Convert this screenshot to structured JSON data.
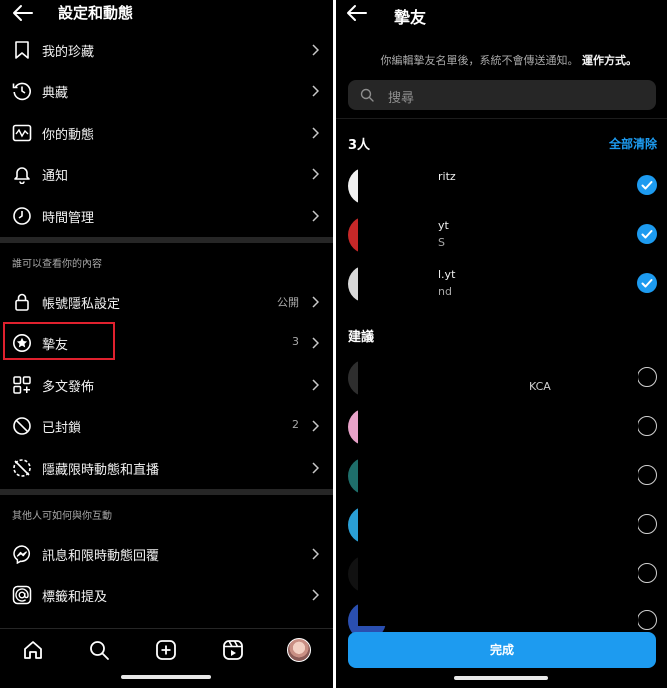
{
  "left_panel": {
    "header": {
      "title": "設定和動態"
    },
    "top_items": [
      {
        "label": "我的珍藏",
        "icon": "bookmark-icon"
      },
      {
        "label": "典藏",
        "icon": "archive-history-icon"
      },
      {
        "label": "你的動態",
        "icon": "activity-icon"
      },
      {
        "label": "通知",
        "icon": "bell-icon"
      },
      {
        "label": "時間管理",
        "icon": "clock-icon"
      }
    ],
    "section1_title": "誰可以查看你的內容",
    "section1_items": [
      {
        "label": "帳號隱私設定",
        "value": "公開",
        "icon": "lock-icon"
      },
      {
        "label": "摯友",
        "value": "3",
        "icon": "close-friends-star-icon"
      },
      {
        "label": "多文發佈",
        "value": "",
        "icon": "crossposting-icon"
      },
      {
        "label": "已封鎖",
        "value": "2",
        "icon": "blocked-icon"
      },
      {
        "label": "隱藏限時動態和直播",
        "value": "",
        "icon": "hide-story-icon"
      }
    ],
    "section2_title": "其他人可如何與你互動",
    "section2_items": [
      {
        "label": "訊息和限時動態回覆",
        "icon": "messenger-icon"
      },
      {
        "label": "標籤和提及",
        "icon": "at-sign-icon"
      }
    ],
    "tabbar": [
      "home-icon",
      "search-icon",
      "create-post-icon",
      "reels-icon",
      "profile-avatar"
    ]
  },
  "right_panel": {
    "header": {
      "title": "摯友"
    },
    "notice_text": "你編輯摯友名單後，系統不會傳送通知。",
    "notice_link": "運作方式。",
    "search_placeholder": "搜尋",
    "selected_count": "3人",
    "clear_all": "全部清除",
    "selected_users": [
      {
        "name": "ritz",
        "sub": ""
      },
      {
        "name": "yt",
        "sub": "S"
      },
      {
        "name": "l.yt",
        "sub": "nd"
      }
    ],
    "suggested_title": "建議",
    "suggested_fragment": "KCA",
    "done_label": "完成"
  },
  "colors": {
    "background": "#000000",
    "accent_blue": "#1d9bf0",
    "highlight_red": "#e0212e",
    "muted_text": "#a8a8a8"
  }
}
